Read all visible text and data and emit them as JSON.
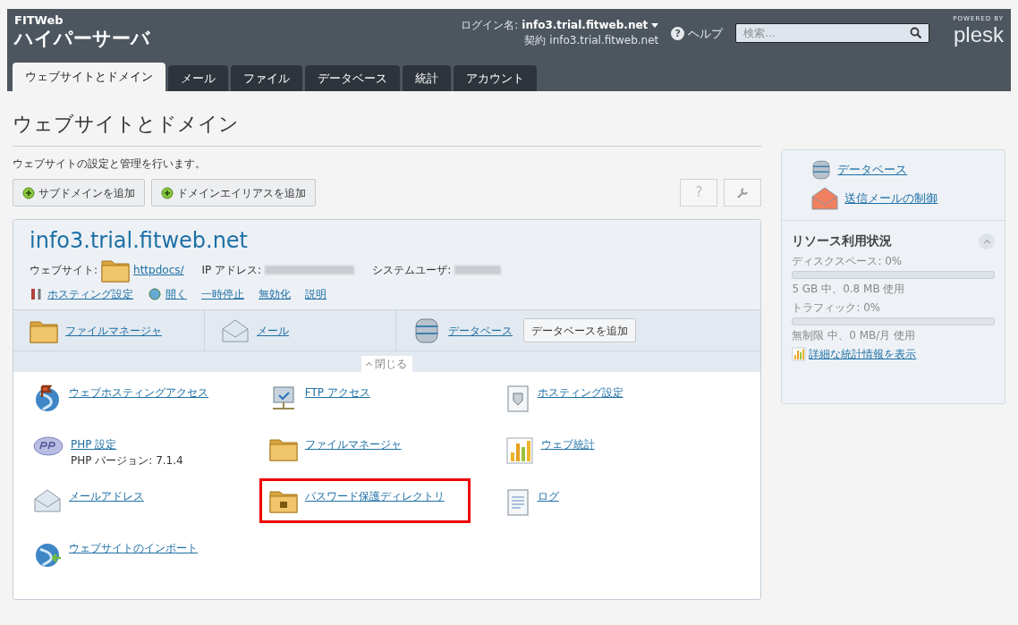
{
  "header": {
    "brand_top": "FITWeb",
    "brand_main": "ハイパーサーバ",
    "login_label": "ログイン名:",
    "login_value": "info3.trial.fitweb.net",
    "contract_label": "契約",
    "contract_value": "info3.trial.fitweb.net",
    "help_icon": "?",
    "help": "ヘルプ",
    "search": {
      "placeholder": "検索..."
    },
    "powered_by": "POWERED BY",
    "logo": "plesk"
  },
  "tabs": [
    {
      "label": "ウェブサイトとドメイン",
      "selected": true
    },
    {
      "label": "メール",
      "selected": false
    },
    {
      "label": "ファイル",
      "selected": false
    },
    {
      "label": "データベース",
      "selected": false
    },
    {
      "label": "統計",
      "selected": false
    },
    {
      "label": "アカウント",
      "selected": false
    }
  ],
  "page": {
    "title": "ウェブサイトとドメイン",
    "description": "ウェブサイトの設定と管理を行います。",
    "buttons": [
      "サブドメインを追加",
      "ドメインエイリアスを追加"
    ],
    "help_button": "?"
  },
  "domain": {
    "name": "info3.trial.fitweb.net",
    "website_label": "ウェブサイト:",
    "website_link": "httpdocs/",
    "ip_label": "IP アドレス:",
    "user_label": "システムユーザ:",
    "actions": [
      "ホスティング設定",
      "開く",
      "一時停止",
      "無効化",
      "説明"
    ],
    "quick": [
      {
        "label": "ファイルマネージャ"
      },
      {
        "label": "メール"
      },
      {
        "label": "データベース",
        "button": "データベースを追加"
      }
    ],
    "collapse": "閉じる",
    "tools": [
      {
        "label": "ウェブホスティングアクセス",
        "highlighted": false
      },
      {
        "label": "FTP アクセス",
        "highlighted": false
      },
      {
        "label": "ホスティング設定",
        "highlighted": false
      },
      {
        "label": "PHP 設定",
        "note": "PHP バージョン: 7.1.4",
        "highlighted": false
      },
      {
        "label": "ファイルマネージャ",
        "highlighted": false
      },
      {
        "label": "ウェブ統計",
        "highlighted": false
      },
      {
        "label": "メールアドレス",
        "highlighted": false
      },
      {
        "label": "パスワード保護ディレクトリ",
        "highlighted": true
      },
      {
        "label": "ログ",
        "highlighted": false
      },
      {
        "label": "ウェブサイトのインポート",
        "highlighted": false
      }
    ]
  },
  "sidebar": {
    "links": [
      "データベース",
      "送信メールの制御"
    ],
    "resources_title": "リソース利用状況",
    "meters": [
      {
        "label": "ディスクスペース: 0%",
        "level": 0,
        "detail": "5 GB 中、0.8 MB 使用"
      },
      {
        "label": "トラフィック: 0%",
        "level": 0,
        "detail": "無制限 中、0 MB/月 使用"
      }
    ],
    "stats_link": "詳細な統計情報を表示"
  }
}
